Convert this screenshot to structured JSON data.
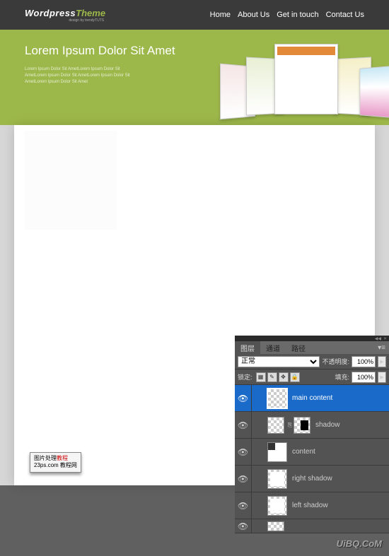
{
  "logo": {
    "part1": "Wordpress",
    "part2": "Theme",
    "sub": "design by trendyTUTS"
  },
  "nav": [
    "Home",
    "About Us",
    "Get in touch",
    "Contact Us"
  ],
  "hero": {
    "title": "Lorem Ipsum Dolor Sit Amet",
    "line1": "Lorem Ipsum Dolor Sit AmetLorem Ipsum Dolor Sit",
    "line2": "AmetLorem Ipsum Dolor Sit AmetLorem Ipsum Dolor Sit",
    "line3": "AmetLorem Ipsum Dolor Sit Amet"
  },
  "caption": {
    "line1": "图片处理",
    "line1b": "教程",
    "line2": "23ps.com 教程网"
  },
  "panel": {
    "tabs": [
      "图层",
      "通道",
      "路径"
    ],
    "blend_mode": "正常",
    "opacity_label": "不透明度:",
    "opacity_value": "100%",
    "lock_label": "锁定:",
    "fill_label": "填充:",
    "fill_value": "100%",
    "layers": [
      {
        "name": "main content",
        "selected": true,
        "mask": false
      },
      {
        "name": "shadow",
        "selected": false,
        "mask": true,
        "linked": true,
        "blackbox": true
      },
      {
        "name": "content",
        "selected": false,
        "mask": false
      },
      {
        "name": "right shadow",
        "selected": false,
        "mask": false
      },
      {
        "name": "left shadow",
        "selected": false,
        "mask": false
      }
    ]
  },
  "watermark": "UiBQ.CoM"
}
